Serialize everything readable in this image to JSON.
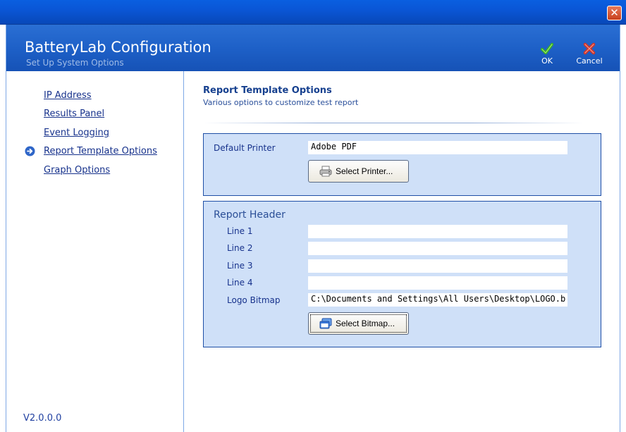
{
  "window": {
    "close_glyph": "✕"
  },
  "header": {
    "title": "BatteryLab Configuration",
    "subtitle": "Set Up System Options",
    "ok_label": "OK",
    "cancel_label": "Cancel",
    "icons": {
      "ok": "checkmark-icon",
      "cancel": "x-icon"
    },
    "colors": {
      "background": "#1d5fc6",
      "ok_icon": "#39b21f",
      "cancel_icon": "#d0352a"
    }
  },
  "sidebar": {
    "items": [
      {
        "label": "IP Address",
        "active": false
      },
      {
        "label": "Results Panel",
        "active": false
      },
      {
        "label": "Event Logging",
        "active": false
      },
      {
        "label": "Report Template Options",
        "active": true
      },
      {
        "label": "Graph Options",
        "active": false
      }
    ],
    "active_indicator_icon": "arrow-right-circle-icon",
    "version": "V2.0.0.0"
  },
  "main": {
    "title": "Report Template Options",
    "subtitle": "Various options to customize test report",
    "printer": {
      "label": "Default Printer",
      "value": "Adobe PDF",
      "button_label": "Select Printer...",
      "button_icon": "printer-icon"
    },
    "report_header": {
      "title": "Report Header",
      "lines": [
        {
          "label": "Line 1",
          "value": ""
        },
        {
          "label": "Line 2",
          "value": ""
        },
        {
          "label": "Line 3",
          "value": ""
        },
        {
          "label": "Line 4",
          "value": ""
        }
      ],
      "logo_label": "Logo Bitmap",
      "logo_value": "C:\\Documents and Settings\\All Users\\Desktop\\LOGO.b",
      "button_label": "Select Bitmap...",
      "button_icon": "window-icon"
    },
    "colors": {
      "panel_bg": "#cfe0f8",
      "panel_border": "#1f4fa6",
      "text": "#17328c"
    }
  }
}
